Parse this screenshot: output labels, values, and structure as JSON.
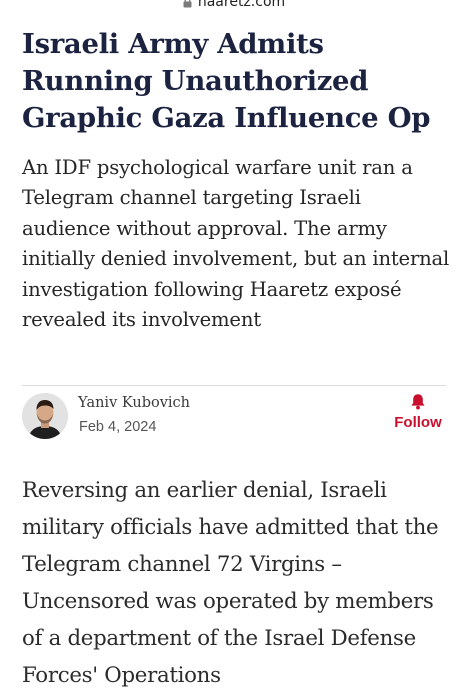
{
  "browser": {
    "url": "haaretz.com",
    "lock_icon": "lock-icon"
  },
  "article": {
    "headline": "Israeli Army Admits Running Unauthorized Graphic Gaza Influence Op",
    "subheadline": "An IDF psychological warfare unit ran a Telegram channel targeting Israeli audience without approval. The army initially denied involvement, but an internal investigation following Haaretz exposé revealed its involvement",
    "author": {
      "name": "Yaniv Kubovich",
      "date": "Feb 4, 2024",
      "avatar_icon": "author-avatar"
    },
    "follow": {
      "label": "Follow",
      "icon": "bell-icon",
      "color": "#c8102e"
    },
    "body_text": "Reversing an earlier denial, Israeli military officials have admitted that the Telegram channel 72 Virgins – Uncensored was operated by members of a department of the Israel Defense Forces' Operations"
  },
  "colors": {
    "headline": "#1c2340",
    "accent": "#c8102e",
    "text": "#2b2b2b"
  }
}
